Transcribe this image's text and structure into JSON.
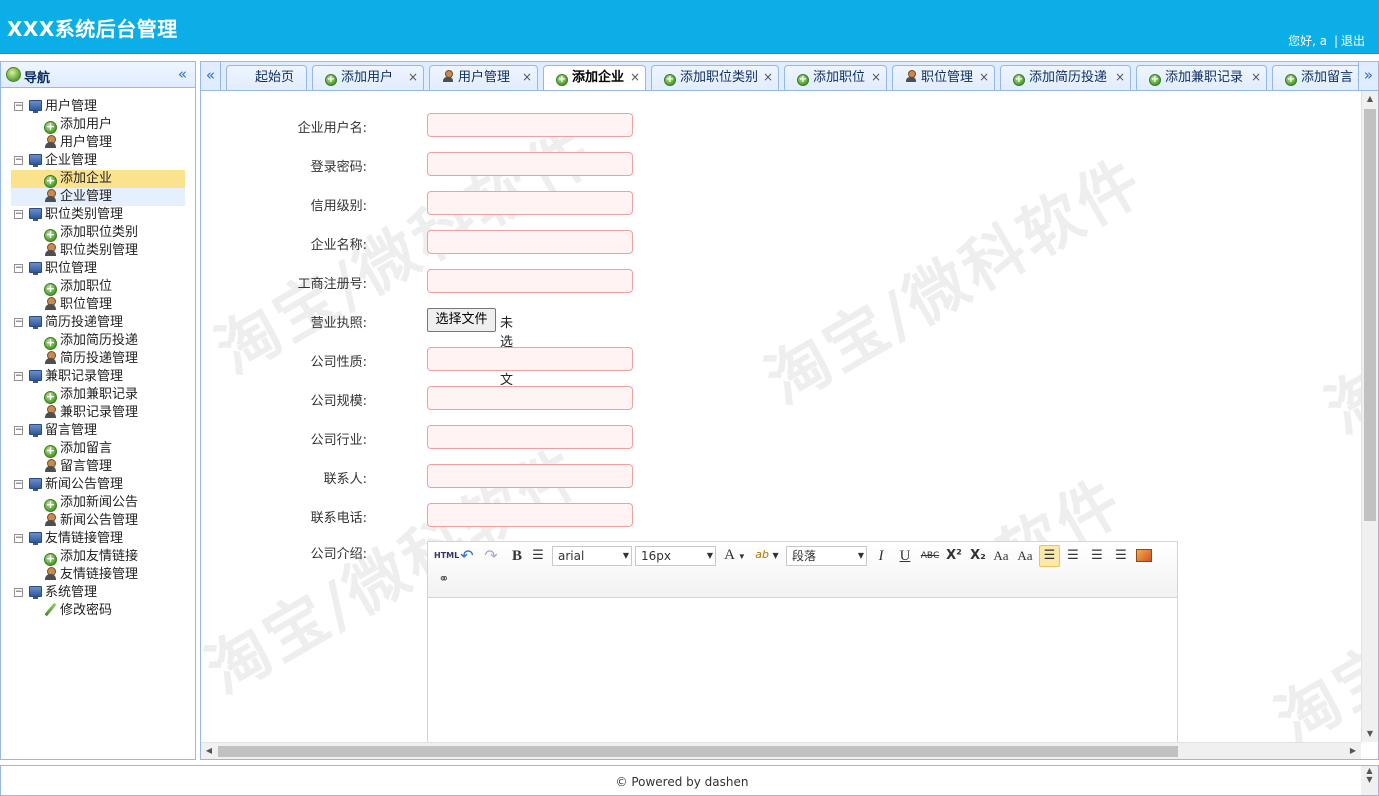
{
  "header": {
    "title": "XXX系统后台管理",
    "greeting": "您好,",
    "username": "a",
    "separator": "|",
    "logout": "退出"
  },
  "nav": {
    "title": "导航",
    "collapse_glyph": "«",
    "tree": [
      {
        "label": "用户管理",
        "children": [
          {
            "label": "添加用户",
            "icon": "add-icon"
          },
          {
            "label": "用户管理",
            "icon": "user-icon"
          }
        ]
      },
      {
        "label": "企业管理",
        "children": [
          {
            "label": "添加企业",
            "icon": "add-icon",
            "selected": true
          },
          {
            "label": "企业管理",
            "icon": "user-icon",
            "hover": true
          }
        ]
      },
      {
        "label": "职位类别管理",
        "children": [
          {
            "label": "添加职位类别",
            "icon": "add-icon"
          },
          {
            "label": "职位类别管理",
            "icon": "user-icon"
          }
        ]
      },
      {
        "label": "职位管理",
        "children": [
          {
            "label": "添加职位",
            "icon": "add-icon"
          },
          {
            "label": "职位管理",
            "icon": "user-icon"
          }
        ]
      },
      {
        "label": "简历投递管理",
        "children": [
          {
            "label": "添加简历投递",
            "icon": "add-icon"
          },
          {
            "label": "简历投递管理",
            "icon": "user-icon"
          }
        ]
      },
      {
        "label": "兼职记录管理",
        "children": [
          {
            "label": "添加兼职记录",
            "icon": "add-icon"
          },
          {
            "label": "兼职记录管理",
            "icon": "user-icon"
          }
        ]
      },
      {
        "label": "留言管理",
        "children": [
          {
            "label": "添加留言",
            "icon": "add-icon"
          },
          {
            "label": "留言管理",
            "icon": "user-icon"
          }
        ]
      },
      {
        "label": "新闻公告管理",
        "children": [
          {
            "label": "添加新闻公告",
            "icon": "add-icon"
          },
          {
            "label": "新闻公告管理",
            "icon": "user-icon"
          }
        ]
      },
      {
        "label": "友情链接管理",
        "children": [
          {
            "label": "添加友情链接",
            "icon": "add-icon"
          },
          {
            "label": "友情链接管理",
            "icon": "user-icon"
          }
        ]
      },
      {
        "label": "系统管理",
        "children": [
          {
            "label": "修改密码",
            "icon": "pen-icon"
          }
        ]
      }
    ]
  },
  "tabs": {
    "scroll_left": "«",
    "scroll_right": "»",
    "close_glyph": "×",
    "items": [
      {
        "label": "起始页",
        "icon": "none",
        "closable": false
      },
      {
        "label": "添加用户",
        "icon": "add-icon",
        "closable": true
      },
      {
        "label": "用户管理",
        "icon": "user-icon",
        "closable": true
      },
      {
        "label": "添加企业",
        "icon": "add-icon",
        "closable": true,
        "active": true
      },
      {
        "label": "添加职位类别",
        "icon": "add-icon",
        "closable": true
      },
      {
        "label": "添加职位",
        "icon": "add-icon",
        "closable": true
      },
      {
        "label": "职位管理",
        "icon": "user-icon",
        "closable": true
      },
      {
        "label": "添加简历投递",
        "icon": "add-icon",
        "closable": true
      },
      {
        "label": "添加兼职记录",
        "icon": "add-icon",
        "closable": true
      },
      {
        "label": "添加留言",
        "icon": "add-icon",
        "closable": true
      }
    ]
  },
  "form": {
    "fields": [
      {
        "label": "企业用户名:",
        "type": "text",
        "value": ""
      },
      {
        "label": "登录密码:",
        "type": "text",
        "value": ""
      },
      {
        "label": "信用级别:",
        "type": "text",
        "value": ""
      },
      {
        "label": "企业名称:",
        "type": "text",
        "value": ""
      },
      {
        "label": "工商注册号:",
        "type": "text",
        "value": ""
      },
      {
        "label": "营业执照:",
        "type": "file",
        "button": "选择文件",
        "status": "未选择文件"
      },
      {
        "label": "公司性质:",
        "type": "text",
        "value": ""
      },
      {
        "label": "公司规模:",
        "type": "text",
        "value": ""
      },
      {
        "label": "公司行业:",
        "type": "text",
        "value": ""
      },
      {
        "label": "联系人:",
        "type": "text",
        "value": ""
      },
      {
        "label": "联系电话:",
        "type": "text",
        "value": ""
      }
    ],
    "intro_label": "公司介绍:"
  },
  "editor": {
    "html_btn": "HTML",
    "undo": "↶",
    "redo": "↷",
    "bold": "B",
    "font_family": "arial",
    "font_size": "16px",
    "font_color": "A",
    "highlight": "ab",
    "paragraph": "段落",
    "italic": "I",
    "underline": "U",
    "strike": "ABC",
    "superscript": "X²",
    "subscript": "X₂",
    "font_grow": "Aa",
    "font_shrink": "Aa",
    "link": "⚭"
  },
  "watermark": {
    "text": "淘宝/微科软件"
  },
  "footer": {
    "text": "© Powered by dashen"
  }
}
